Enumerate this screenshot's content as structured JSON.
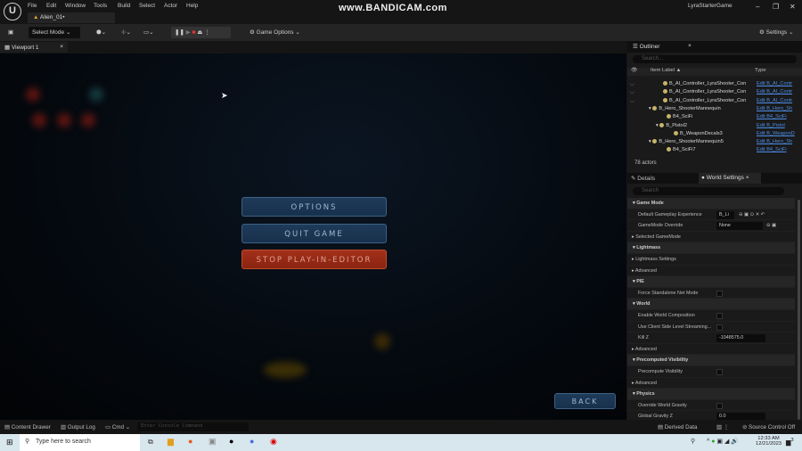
{
  "menu": {
    "items": [
      "File",
      "Edit",
      "Window",
      "Tools",
      "Build",
      "Select",
      "Actor",
      "Help"
    ],
    "level_tab": "Alien_01•",
    "project": "LyraStarterGame",
    "watermark": "www.BANDICAM.com"
  },
  "toolbar": {
    "select_mode": "Select Mode",
    "game_options": "Game Options",
    "settings": "Settings"
  },
  "viewport": {
    "tab": "Viewport 1",
    "buttons": {
      "options": "OPTIONS",
      "quit": "QUIT GAME",
      "stop": "STOP PLAY-IN-EDITOR",
      "back": "BACK"
    }
  },
  "outliner": {
    "title": "Outliner",
    "search_placeholder": "Search...",
    "col_label": "Item Label ▲",
    "col_type": "Type",
    "footer": "78 actors",
    "rows": [
      {
        "label": "B_AI_Controller_LyraShooter_Con",
        "type": "Edit B_AI_Contr"
      },
      {
        "label": "B_AI_Controller_LyraShooter_Con",
        "type": "Edit B_AI_Contr"
      },
      {
        "label": "B_AI_Controller_LyraShooter_Con",
        "type": "Edit B_AI_Contr"
      },
      {
        "label": "B_Hero_ShooterMannequin",
        "type": "Edit B_Hero_Sh"
      },
      {
        "label": "B4_SciFi",
        "type": "Edit B4_SciFi"
      },
      {
        "label": "B_Pistol2",
        "type": "Edit B_Pistol"
      },
      {
        "label": "B_WeaponDecals3",
        "type": "Edit B_WeaponD"
      },
      {
        "label": "B_Hero_ShooterMannequin5",
        "type": "Edit B_Hero_Sh"
      },
      {
        "label": "B4_SciFi7",
        "type": "Edit B4_SciFi"
      }
    ]
  },
  "details": {
    "tab_details": "Details",
    "tab_world": "World Settings",
    "search_placeholder": "Search",
    "rows": [
      {
        "label": "Game Mode",
        "kind": "section"
      },
      {
        "label": "Default Gameplay Experience",
        "value": "B_Li"
      },
      {
        "label": "GameMode Override",
        "value": "None"
      },
      {
        "label": "Selected GameMode",
        "kind": "group"
      },
      {
        "label": "Lightmass",
        "kind": "section"
      },
      {
        "label": "Lightmass Settings",
        "kind": "group"
      },
      {
        "label": "Advanced",
        "kind": "group"
      },
      {
        "label": "PIE",
        "kind": "section"
      },
      {
        "label": "Force Standalone Net Mode",
        "kind": "check"
      },
      {
        "label": "World",
        "kind": "section"
      },
      {
        "label": "Enable World Composition",
        "kind": "check"
      },
      {
        "label": "Use Client Side Level Streaming...",
        "kind": "check"
      },
      {
        "label": "Kill Z",
        "value": "-1048575.0"
      },
      {
        "label": "Advanced",
        "kind": "group"
      },
      {
        "label": "Precomputed Visibility",
        "kind": "section"
      },
      {
        "label": "Precompute Visibility",
        "kind": "check"
      },
      {
        "label": "Advanced",
        "kind": "group"
      },
      {
        "label": "Physics",
        "kind": "section"
      },
      {
        "label": "Override World Gravity",
        "kind": "check"
      },
      {
        "label": "Global Gravity Z",
        "value": "0.0"
      }
    ]
  },
  "bottombar": {
    "content_drawer": "Content Drawer",
    "output_log": "Output Log",
    "cmd": "Cmd",
    "console_placeholder": "Enter Console Command",
    "derived_data": "Derived Data",
    "source_control": "Source Control Off"
  },
  "taskbar": {
    "search_placeholder": "Type here to search",
    "time": "12:33 AM",
    "date": "12/21/2023",
    "notifications": "3"
  }
}
